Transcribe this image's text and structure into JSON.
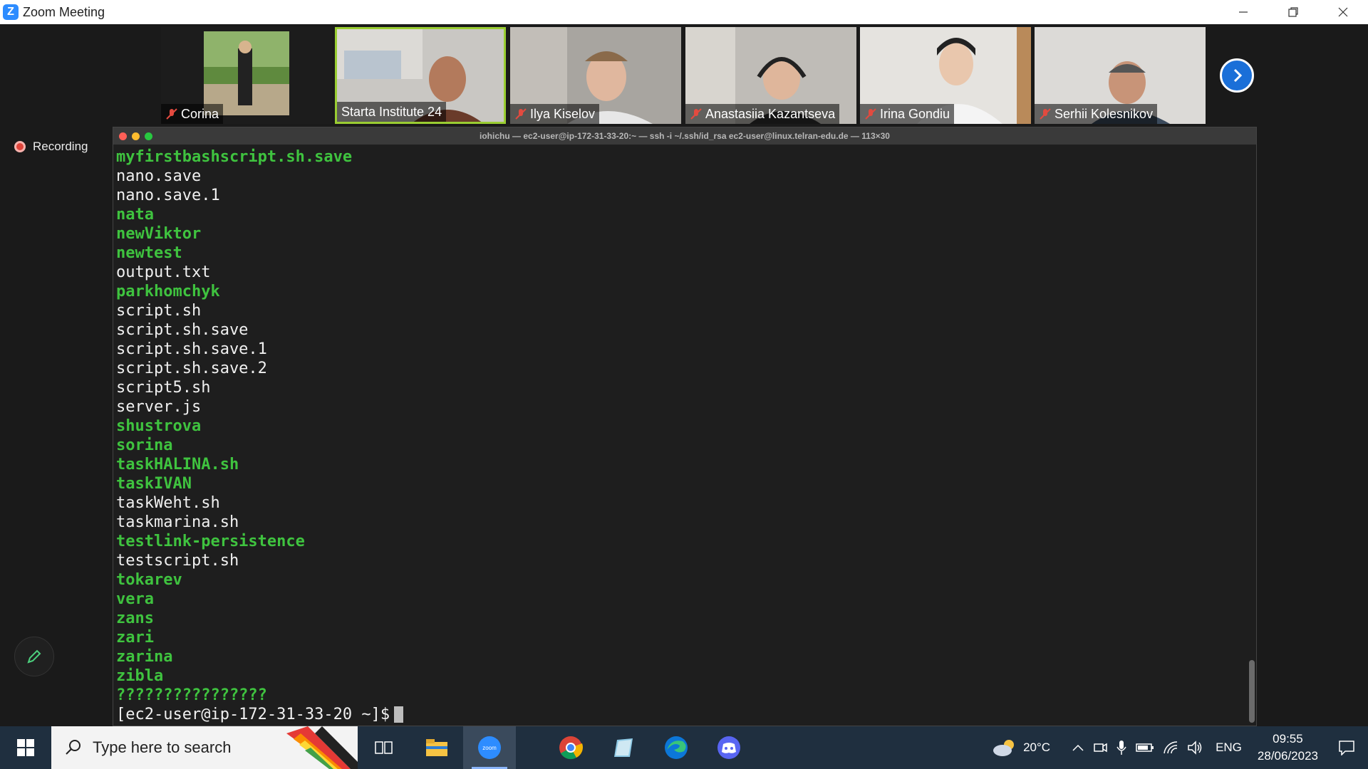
{
  "window": {
    "title": "Zoom Meeting",
    "controls": [
      "minimize",
      "restore",
      "close"
    ]
  },
  "participants": [
    {
      "name": "Corina",
      "muted": true,
      "active": false
    },
    {
      "name": "Starta Institute 24",
      "muted": false,
      "active": true
    },
    {
      "name": "Ilya Kiselov",
      "muted": true,
      "active": false
    },
    {
      "name": "Anastasiia Kazantseva",
      "muted": true,
      "active": false
    },
    {
      "name": "Irina Gondiu",
      "muted": true,
      "active": false
    },
    {
      "name": "Serhii Kolesnikov",
      "muted": true,
      "active": false
    }
  ],
  "recording": {
    "label": "Recording"
  },
  "terminal": {
    "title": "iohichu — ec2-user@ip-172-31-33-20:~ — ssh -i ~/.ssh/id_rsa ec2-user@linux.telran-edu.de — 113×30",
    "lines": [
      {
        "text": "myfirstbashscript.sh.save",
        "dir": true
      },
      {
        "text": "nano.save",
        "dir": false
      },
      {
        "text": "nano.save.1",
        "dir": false
      },
      {
        "text": "nata",
        "dir": true
      },
      {
        "text": "newViktor",
        "dir": true
      },
      {
        "text": "newtest",
        "dir": true
      },
      {
        "text": "output.txt",
        "dir": false
      },
      {
        "text": "parkhomchyk",
        "dir": true
      },
      {
        "text": "script.sh",
        "dir": false
      },
      {
        "text": "script.sh.save",
        "dir": false
      },
      {
        "text": "script.sh.save.1",
        "dir": false
      },
      {
        "text": "script.sh.save.2",
        "dir": false
      },
      {
        "text": "script5.sh",
        "dir": false
      },
      {
        "text": "server.js",
        "dir": false
      },
      {
        "text": "shustrova",
        "dir": true
      },
      {
        "text": "sorina",
        "dir": true
      },
      {
        "text": "taskHALINA.sh",
        "dir": true
      },
      {
        "text": "taskIVAN",
        "dir": true
      },
      {
        "text": "taskWeht.sh",
        "dir": false
      },
      {
        "text": "taskmarina.sh",
        "dir": false
      },
      {
        "text": "testlink-persistence",
        "dir": true
      },
      {
        "text": "testscript.sh",
        "dir": false
      },
      {
        "text": "tokarev",
        "dir": true
      },
      {
        "text": "vera",
        "dir": true
      },
      {
        "text": "zans",
        "dir": true
      },
      {
        "text": "zari",
        "dir": true
      },
      {
        "text": "zarina",
        "dir": true
      },
      {
        "text": "zibla",
        "dir": true
      },
      {
        "text": "????????????????",
        "dir": true
      }
    ],
    "prompt": "[ec2-user@ip-172-31-33-20 ~]$"
  },
  "taskbar": {
    "search_placeholder": "Type here to search",
    "weather": "20°C",
    "language": "ENG",
    "time": "09:55",
    "date": "28/06/2023",
    "apps": [
      "task-view",
      "file-explorer",
      "zoom",
      "chrome",
      "notes",
      "edge",
      "discord"
    ]
  },
  "colors": {
    "dir_green": "#3fc33f",
    "active_border": "#9acd32",
    "zoom_blue": "#2d8cff",
    "taskbar_bg": "#1f2f3f"
  }
}
